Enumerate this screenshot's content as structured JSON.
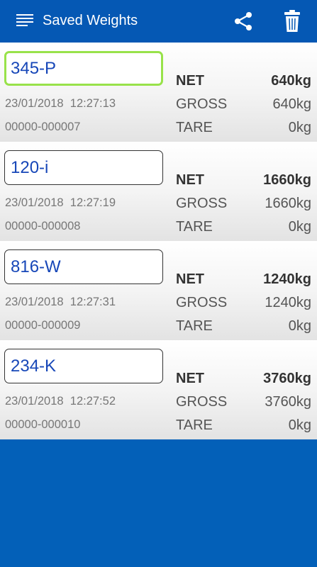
{
  "appbar": {
    "title": "Saved Weights",
    "menu_icon": "menu-icon",
    "share_icon": "share-icon",
    "delete_icon": "trash-icon",
    "background": "#0558b4"
  },
  "labels": {
    "net": "NET",
    "gross": "GROSS",
    "tare": "TARE"
  },
  "records": [
    {
      "id": "345-P",
      "date": "23/01/2018",
      "time": "12:27:13",
      "ticket": "00000-000007",
      "net": "640kg",
      "gross": "640kg",
      "tare": "0kg",
      "focused": true
    },
    {
      "id": "120-i",
      "date": "23/01/2018",
      "time": "12:27:19",
      "ticket": "00000-000008",
      "net": "1660kg",
      "gross": "1660kg",
      "tare": "0kg",
      "focused": false
    },
    {
      "id": "816-W",
      "date": "23/01/2018",
      "time": "12:27:31",
      "ticket": "00000-000009",
      "net": "1240kg",
      "gross": "1240kg",
      "tare": "0kg",
      "focused": false
    },
    {
      "id": "234-K",
      "date": "23/01/2018",
      "time": "12:27:52",
      "ticket": "00000-000010",
      "net": "3760kg",
      "gross": "3760kg",
      "tare": "0kg",
      "focused": false
    }
  ],
  "colors": {
    "accent_focus": "#98e24a",
    "id_text": "#1747b8",
    "page_bg": "#0360b8"
  }
}
